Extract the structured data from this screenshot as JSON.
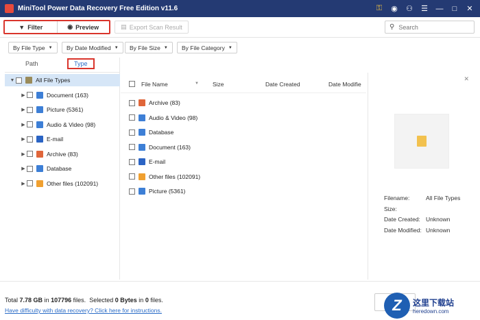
{
  "window": {
    "title": "MiniTool Power Data Recovery Free Edition v11.6"
  },
  "titlebar_icons": [
    "key-icon",
    "disc-icon",
    "headphones-icon",
    "menu-icon",
    "minimize-icon",
    "maximize-icon",
    "close-icon"
  ],
  "toolbar": {
    "filter_label": "Filter",
    "preview_label": "Preview",
    "export_label": "Export Scan Result",
    "search_placeholder": "Search"
  },
  "filters": [
    "By File Type",
    "By Date Modified",
    "By File Size",
    "By File Category"
  ],
  "tabs": {
    "path": "Path",
    "type": "Type"
  },
  "tree": [
    {
      "label": "All File Types",
      "icon": "folder-icon",
      "color": "#9a8b5a"
    },
    {
      "label": "Document (163)",
      "icon": "document-icon",
      "color": "#3d7fd6"
    },
    {
      "label": "Picture (5361)",
      "icon": "picture-icon",
      "color": "#3d7fd6"
    },
    {
      "label": "Audio & Video (98)",
      "icon": "audio-video-icon",
      "color": "#3d7fd6"
    },
    {
      "label": "E-mail",
      "icon": "email-icon",
      "color": "#2b64c4"
    },
    {
      "label": "Archive (83)",
      "icon": "archive-icon",
      "color": "#e0663a"
    },
    {
      "label": "Database",
      "icon": "database-icon",
      "color": "#3d7fd6"
    },
    {
      "label": "Other files (102091)",
      "icon": "other-files-icon",
      "color": "#f0a030"
    }
  ],
  "columns": [
    "File Name",
    "Size",
    "Date Created",
    "Date Modifie"
  ],
  "list": [
    {
      "label": "Archive (83)",
      "icon": "archive-icon",
      "color": "#e0663a"
    },
    {
      "label": "Audio & Video (98)",
      "icon": "audio-video-icon",
      "color": "#3d7fd6"
    },
    {
      "label": "Database",
      "icon": "database-icon",
      "color": "#3d7fd6"
    },
    {
      "label": "Document (163)",
      "icon": "document-icon",
      "color": "#3d7fd6"
    },
    {
      "label": "E-mail",
      "icon": "email-icon",
      "color": "#2b64c4"
    },
    {
      "label": "Other files (102091)",
      "icon": "other-files-icon",
      "color": "#f0a030"
    },
    {
      "label": "Picture (5361)",
      "icon": "picture-icon",
      "color": "#3d7fd6"
    }
  ],
  "details": {
    "filename_label": "Filename:",
    "filename_value": "All File Types",
    "size_label": "Size:",
    "size_value": "",
    "created_label": "Date Created:",
    "created_value": "Unknown",
    "modified_label": "Date Modified:",
    "modified_value": "Unknown"
  },
  "status": {
    "total_prefix": "Total",
    "total_size": "7.78 GB",
    "in_1": "in",
    "total_files": "107796",
    "files_1": "files.",
    "selected_prefix": "Selected",
    "selected_size": "0 Bytes",
    "in_2": "in",
    "selected_files": "0",
    "files_2": "files.",
    "help_link": "Have difficulty with data recovery? Click here for instructions."
  },
  "watermark": {
    "badge": "Z",
    "cn": "这里下载站",
    "url": "heredown.com"
  },
  "colors": {
    "titlebar": "#243a73",
    "accent": "#2a6cc7",
    "highlight_border": "#d9342b"
  }
}
